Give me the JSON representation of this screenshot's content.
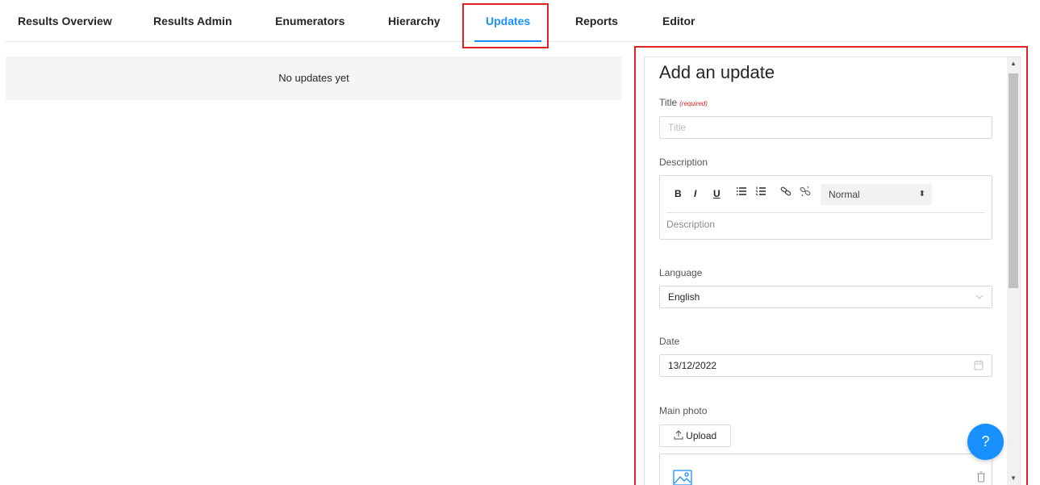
{
  "tabs": [
    {
      "label": "Results Overview",
      "active": false
    },
    {
      "label": "Results Admin",
      "active": false
    },
    {
      "label": "Enumerators",
      "active": false
    },
    {
      "label": "Hierarchy",
      "active": false
    },
    {
      "label": "Updates",
      "active": true
    },
    {
      "label": "Reports",
      "active": false
    },
    {
      "label": "Editor",
      "active": false
    }
  ],
  "updates_list": {
    "empty_text": "No updates yet"
  },
  "form": {
    "heading": "Add an update",
    "title_label": "Title",
    "title_required": "(required)",
    "title_placeholder": "Title",
    "description_label": "Description",
    "description_placeholder": "Description",
    "toolbar": {
      "bold": "B",
      "italic": "I",
      "underline": "U",
      "format_select": "Normal"
    },
    "language_label": "Language",
    "language_value": "English",
    "date_label": "Date",
    "date_value": "13/12/2022",
    "photo_label": "Main photo",
    "upload_label": "Upload"
  },
  "help_button": {
    "label": "?"
  },
  "colors": {
    "accent": "#1890ff",
    "highlight": "#e02424"
  }
}
